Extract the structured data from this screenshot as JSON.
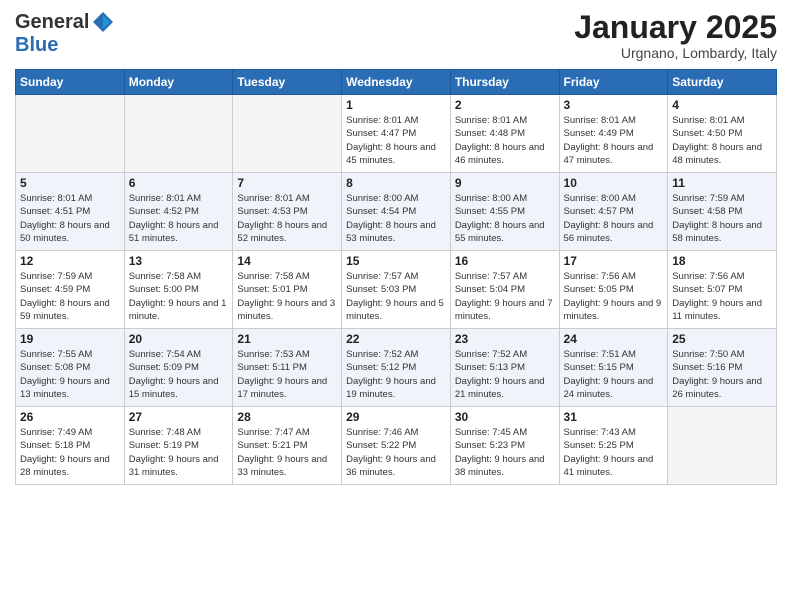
{
  "header": {
    "logo_general": "General",
    "logo_blue": "Blue",
    "month_title": "January 2025",
    "subtitle": "Urgnano, Lombardy, Italy"
  },
  "weekdays": [
    "Sunday",
    "Monday",
    "Tuesday",
    "Wednesday",
    "Thursday",
    "Friday",
    "Saturday"
  ],
  "weeks": [
    [
      {
        "day": "",
        "sunrise": "",
        "sunset": "",
        "daylight": ""
      },
      {
        "day": "",
        "sunrise": "",
        "sunset": "",
        "daylight": ""
      },
      {
        "day": "",
        "sunrise": "",
        "sunset": "",
        "daylight": ""
      },
      {
        "day": "1",
        "sunrise": "Sunrise: 8:01 AM",
        "sunset": "Sunset: 4:47 PM",
        "daylight": "Daylight: 8 hours and 45 minutes."
      },
      {
        "day": "2",
        "sunrise": "Sunrise: 8:01 AM",
        "sunset": "Sunset: 4:48 PM",
        "daylight": "Daylight: 8 hours and 46 minutes."
      },
      {
        "day": "3",
        "sunrise": "Sunrise: 8:01 AM",
        "sunset": "Sunset: 4:49 PM",
        "daylight": "Daylight: 8 hours and 47 minutes."
      },
      {
        "day": "4",
        "sunrise": "Sunrise: 8:01 AM",
        "sunset": "Sunset: 4:50 PM",
        "daylight": "Daylight: 8 hours and 48 minutes."
      }
    ],
    [
      {
        "day": "5",
        "sunrise": "Sunrise: 8:01 AM",
        "sunset": "Sunset: 4:51 PM",
        "daylight": "Daylight: 8 hours and 50 minutes."
      },
      {
        "day": "6",
        "sunrise": "Sunrise: 8:01 AM",
        "sunset": "Sunset: 4:52 PM",
        "daylight": "Daylight: 8 hours and 51 minutes."
      },
      {
        "day": "7",
        "sunrise": "Sunrise: 8:01 AM",
        "sunset": "Sunset: 4:53 PM",
        "daylight": "Daylight: 8 hours and 52 minutes."
      },
      {
        "day": "8",
        "sunrise": "Sunrise: 8:00 AM",
        "sunset": "Sunset: 4:54 PM",
        "daylight": "Daylight: 8 hours and 53 minutes."
      },
      {
        "day": "9",
        "sunrise": "Sunrise: 8:00 AM",
        "sunset": "Sunset: 4:55 PM",
        "daylight": "Daylight: 8 hours and 55 minutes."
      },
      {
        "day": "10",
        "sunrise": "Sunrise: 8:00 AM",
        "sunset": "Sunset: 4:57 PM",
        "daylight": "Daylight: 8 hours and 56 minutes."
      },
      {
        "day": "11",
        "sunrise": "Sunrise: 7:59 AM",
        "sunset": "Sunset: 4:58 PM",
        "daylight": "Daylight: 8 hours and 58 minutes."
      }
    ],
    [
      {
        "day": "12",
        "sunrise": "Sunrise: 7:59 AM",
        "sunset": "Sunset: 4:59 PM",
        "daylight": "Daylight: 8 hours and 59 minutes."
      },
      {
        "day": "13",
        "sunrise": "Sunrise: 7:58 AM",
        "sunset": "Sunset: 5:00 PM",
        "daylight": "Daylight: 9 hours and 1 minute."
      },
      {
        "day": "14",
        "sunrise": "Sunrise: 7:58 AM",
        "sunset": "Sunset: 5:01 PM",
        "daylight": "Daylight: 9 hours and 3 minutes."
      },
      {
        "day": "15",
        "sunrise": "Sunrise: 7:57 AM",
        "sunset": "Sunset: 5:03 PM",
        "daylight": "Daylight: 9 hours and 5 minutes."
      },
      {
        "day": "16",
        "sunrise": "Sunrise: 7:57 AM",
        "sunset": "Sunset: 5:04 PM",
        "daylight": "Daylight: 9 hours and 7 minutes."
      },
      {
        "day": "17",
        "sunrise": "Sunrise: 7:56 AM",
        "sunset": "Sunset: 5:05 PM",
        "daylight": "Daylight: 9 hours and 9 minutes."
      },
      {
        "day": "18",
        "sunrise": "Sunrise: 7:56 AM",
        "sunset": "Sunset: 5:07 PM",
        "daylight": "Daylight: 9 hours and 11 minutes."
      }
    ],
    [
      {
        "day": "19",
        "sunrise": "Sunrise: 7:55 AM",
        "sunset": "Sunset: 5:08 PM",
        "daylight": "Daylight: 9 hours and 13 minutes."
      },
      {
        "day": "20",
        "sunrise": "Sunrise: 7:54 AM",
        "sunset": "Sunset: 5:09 PM",
        "daylight": "Daylight: 9 hours and 15 minutes."
      },
      {
        "day": "21",
        "sunrise": "Sunrise: 7:53 AM",
        "sunset": "Sunset: 5:11 PM",
        "daylight": "Daylight: 9 hours and 17 minutes."
      },
      {
        "day": "22",
        "sunrise": "Sunrise: 7:52 AM",
        "sunset": "Sunset: 5:12 PM",
        "daylight": "Daylight: 9 hours and 19 minutes."
      },
      {
        "day": "23",
        "sunrise": "Sunrise: 7:52 AM",
        "sunset": "Sunset: 5:13 PM",
        "daylight": "Daylight: 9 hours and 21 minutes."
      },
      {
        "day": "24",
        "sunrise": "Sunrise: 7:51 AM",
        "sunset": "Sunset: 5:15 PM",
        "daylight": "Daylight: 9 hours and 24 minutes."
      },
      {
        "day": "25",
        "sunrise": "Sunrise: 7:50 AM",
        "sunset": "Sunset: 5:16 PM",
        "daylight": "Daylight: 9 hours and 26 minutes."
      }
    ],
    [
      {
        "day": "26",
        "sunrise": "Sunrise: 7:49 AM",
        "sunset": "Sunset: 5:18 PM",
        "daylight": "Daylight: 9 hours and 28 minutes."
      },
      {
        "day": "27",
        "sunrise": "Sunrise: 7:48 AM",
        "sunset": "Sunset: 5:19 PM",
        "daylight": "Daylight: 9 hours and 31 minutes."
      },
      {
        "day": "28",
        "sunrise": "Sunrise: 7:47 AM",
        "sunset": "Sunset: 5:21 PM",
        "daylight": "Daylight: 9 hours and 33 minutes."
      },
      {
        "day": "29",
        "sunrise": "Sunrise: 7:46 AM",
        "sunset": "Sunset: 5:22 PM",
        "daylight": "Daylight: 9 hours and 36 minutes."
      },
      {
        "day": "30",
        "sunrise": "Sunrise: 7:45 AM",
        "sunset": "Sunset: 5:23 PM",
        "daylight": "Daylight: 9 hours and 38 minutes."
      },
      {
        "day": "31",
        "sunrise": "Sunrise: 7:43 AM",
        "sunset": "Sunset: 5:25 PM",
        "daylight": "Daylight: 9 hours and 41 minutes."
      },
      {
        "day": "",
        "sunrise": "",
        "sunset": "",
        "daylight": ""
      }
    ]
  ]
}
